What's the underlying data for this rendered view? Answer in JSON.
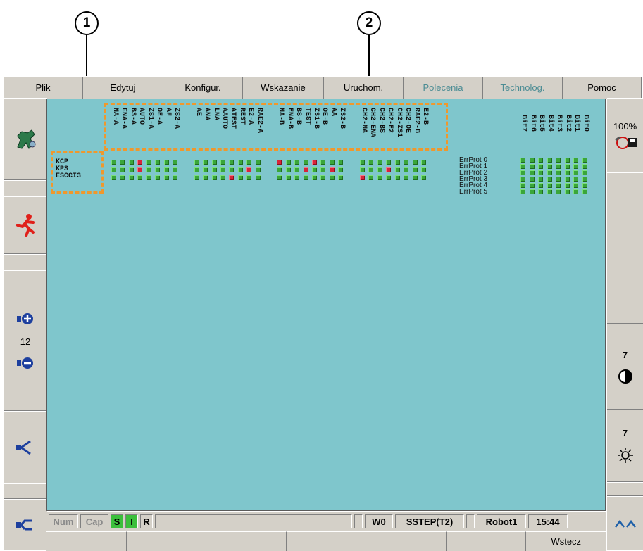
{
  "callouts": {
    "one": "1",
    "two": "2"
  },
  "menu": {
    "items": [
      {
        "label": "Plik"
      },
      {
        "label": "Edytuj"
      },
      {
        "label": "Konfigur."
      },
      {
        "label": "Wskazanie"
      },
      {
        "label": "Uruchom."
      },
      {
        "label": "Polecenia"
      },
      {
        "label": "Technolog."
      },
      {
        "label": "Pomoc"
      }
    ]
  },
  "left_sidebar": {
    "jog_count": "12"
  },
  "right_sidebar": {
    "override": "100%",
    "contrast_value": "7",
    "brightness_value": "7"
  },
  "group_labels": [
    "KCP",
    "KPS",
    "ESCCI3"
  ],
  "signals": [
    "NA-A",
    "ENA-A",
    "BS-A",
    "AUTO",
    "ZS1-A",
    "OE-A",
    "AF",
    "ZS2-A",
    "AE",
    "ANA",
    "LNA",
    "AAUTO",
    "ATEST",
    "REST",
    "E2-A",
    "RAE2-A",
    "NA-B",
    "ENA-B",
    "BS-B",
    "TEST",
    "ZS1-B",
    "OE-B",
    "AA",
    "ZS2-B",
    "CH2-NA",
    "CH2-ENA",
    "CH2-BS",
    "CH2-E2",
    "CH2-ZS1",
    "CH2-OE",
    "RAE2-B",
    "E2-B"
  ],
  "bits": [
    "Bit7",
    "Bit6",
    "Bit5",
    "Bit4",
    "Bit3",
    "Bit2",
    "Bit1",
    "Bit0"
  ],
  "err_prot": [
    "ErrProt 0",
    "ErrProt 1",
    "ErrProt 2",
    "ErrProt 3",
    "ErrProt 4",
    "ErrProt 5"
  ],
  "led_red": [
    [
      3,
      16,
      20
    ],
    [
      3,
      14,
      19,
      22,
      27
    ],
    [
      12,
      24
    ]
  ],
  "status": {
    "num": "Num",
    "cap": "Cap",
    "s": "S",
    "i": "I",
    "r": "R",
    "w0": "W0",
    "mode": "SSTEP(T2)",
    "robot": "Robot1",
    "time": "15:44"
  },
  "softkeys": [
    "",
    "",
    "",
    "",
    "",
    "",
    "Wstecz"
  ],
  "colors": {
    "display_bg": "#7fc6cc",
    "chrome": "#d4d0c8",
    "led_green": "#3aa63a",
    "led_red": "#d8243a",
    "highlight": "#f0982c"
  }
}
